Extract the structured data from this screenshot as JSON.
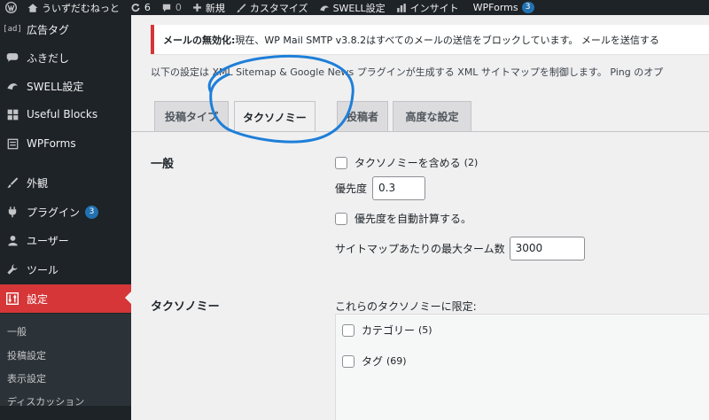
{
  "adminbar": {
    "site_name": "ういずだむねっと",
    "updates_count": "6",
    "comments_count": "0",
    "new_label": "新規",
    "customize_label": "カスタマイズ",
    "swell_label": "SWELL設定",
    "insights_label": "インサイト",
    "wpforms_label": "WPForms",
    "wpforms_badge": "3"
  },
  "sidebar": {
    "items": [
      {
        "label": "広告タグ",
        "icon": "ad-icon"
      },
      {
        "label": "ふきだし",
        "icon": "speech-bubble-icon"
      },
      {
        "label": "SWELL設定",
        "icon": "swell-icon"
      },
      {
        "label": "Useful Blocks",
        "icon": "blocks-icon"
      },
      {
        "label": "WPForms",
        "icon": "form-icon"
      },
      {
        "label": "外観",
        "icon": "brush-icon"
      },
      {
        "label": "プラグイン",
        "icon": "plugin-icon",
        "badge": "3"
      },
      {
        "label": "ユーザー",
        "icon": "user-icon"
      },
      {
        "label": "ツール",
        "icon": "wrench-icon"
      },
      {
        "label": "設定",
        "icon": "settings-icon"
      }
    ],
    "submenu": [
      "一般",
      "投稿設定",
      "表示設定",
      "ディスカッション"
    ]
  },
  "notice": {
    "bold": "メールの無効化:",
    "text": " 現在、WP Mail SMTP v3.8.2はすべてのメールの送信をブロックしています。 メールを送信する"
  },
  "description": "以下の設定は XML Sitemap & Google News プラグインが生成する XML サイトマップを制御します。 Ping のオプ",
  "tabs": [
    "投稿タイプ",
    "タクソノミー",
    "投稿者",
    "高度な設定"
  ],
  "general": {
    "heading": "一般",
    "include_taxonomies": "タクソノミーを含める",
    "include_taxonomies_count": "(2)",
    "priority_label": "優先度",
    "priority_value": "0.3",
    "auto_priority": "優先度を自動計算する。",
    "max_terms_label": "サイトマップあたりの最大ターム数",
    "max_terms_value": "3000"
  },
  "taxonomy": {
    "heading": "タクソノミー",
    "limit_label": "これらのタクソノミーに限定:",
    "items": [
      {
        "label": "カテゴリー",
        "count": "(5)"
      },
      {
        "label": "タグ",
        "count": "(69)"
      }
    ]
  },
  "colors": {
    "admin_dark": "#1d2327",
    "active_red": "#d63638",
    "badge_blue": "#2271b1",
    "annotation_blue": "#1e7fd8"
  }
}
